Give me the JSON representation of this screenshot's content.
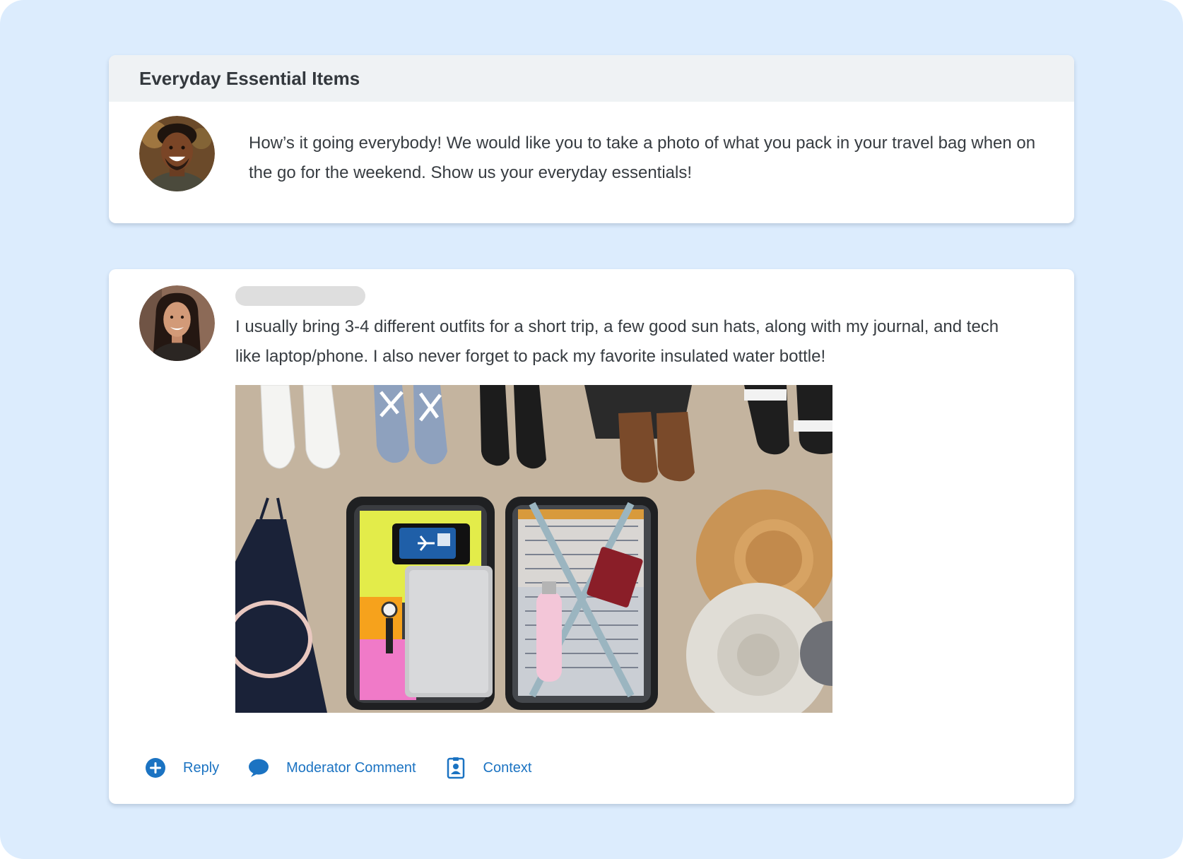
{
  "prompt_card": {
    "title": "Everyday Essential Items",
    "avatar_icon": "moderator-avatar",
    "text": "How’s it going everybody! We would like you to take a photo of what you pack in your travel bag when on the go for the weekend. Show us your everyday essentials!"
  },
  "response_card": {
    "avatar_icon": "participant-avatar",
    "author_name": "",
    "text": "I usually bring 3-4 different outfits for a short trip, a few good sun hats, along with my journal, and tech like laptop/phone. I also never forget to pack my favorite insulated water bottle!",
    "photo_icon": "packed-suitcase-photo"
  },
  "actions": [
    {
      "label": "Reply",
      "icon": "plus-circle-icon"
    },
    {
      "label": "Moderator Comment",
      "icon": "speech-bubble-icon"
    },
    {
      "label": "Context",
      "icon": "id-badge-icon"
    }
  ],
  "colors": {
    "background": "#dcecfd",
    "card": "#ffffff",
    "header": "#eff2f4",
    "link": "#1b73c2"
  }
}
